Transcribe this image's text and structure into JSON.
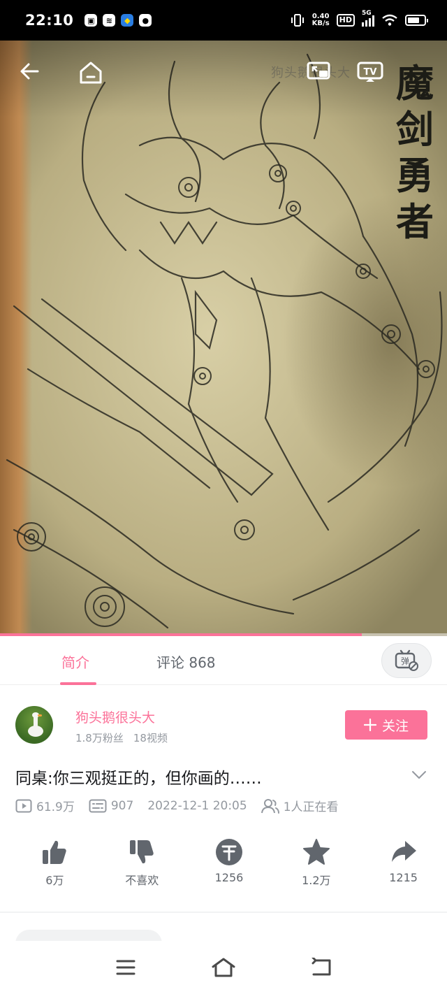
{
  "status_bar": {
    "time": "22:10",
    "net_speed_value": "0.40",
    "net_speed_unit": "KB/s",
    "hd": "HD",
    "network": "5G"
  },
  "video": {
    "watermark": "狗头鹅很头大",
    "calligraphy": "魔剑勇者",
    "progress": 0.81,
    "accent_color": "#fb7299"
  },
  "tabs": [
    {
      "label": "简介",
      "active": true
    },
    {
      "label": "评论 868",
      "active": false
    }
  ],
  "danmaku_toggle_icon": "danmaku-off-icon",
  "uploader": {
    "name": "狗头鹅很头大",
    "fans": "1.8万粉丝",
    "videos": "18视频",
    "follow_label": "关注"
  },
  "title": "同桌:你三观挺正的，但你画的……",
  "meta": {
    "plays": "61.9万",
    "danmaku": "907",
    "date": "2022-12-1 20:05",
    "watching": "1人正在看"
  },
  "actions": [
    {
      "icon": "like-icon",
      "label": "6万"
    },
    {
      "icon": "dislike-icon",
      "label": "不喜欢"
    },
    {
      "icon": "coin-icon",
      "label": "1256"
    },
    {
      "icon": "favorite-icon",
      "label": "1.2万"
    },
    {
      "icon": "share-icon",
      "label": "1215"
    }
  ],
  "nav": [
    "menu-icon",
    "home-icon",
    "back-icon"
  ]
}
